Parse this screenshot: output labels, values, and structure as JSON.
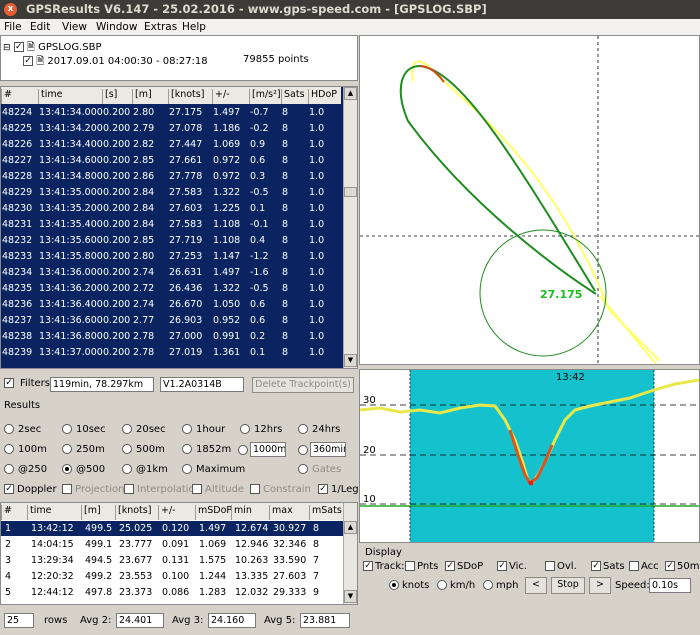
{
  "window": {
    "title": "GPSResults V6.147 - 25.02.2016 - www.gps-speed.com - [GPSLOG.SBP]",
    "close": "x"
  },
  "menu": [
    "File",
    "Edit",
    "View",
    "Window",
    "Extras",
    "Help"
  ],
  "tree": {
    "file": "GPSLOG.SBP",
    "session": "2017.09.01 04:00:30 - 08:27:18",
    "points": "79855 points"
  },
  "trackpoints": {
    "headers": [
      "#",
      "time",
      "[s]",
      "[m]",
      "[knots]",
      "+/-",
      "[m/s²]",
      "Sats",
      "HDoP"
    ],
    "rows": [
      [
        "48224",
        "13:41:34.000",
        "0.200",
        "2.80",
        "27.175",
        "1.497",
        "-0.7",
        "8",
        "1.0"
      ],
      [
        "48225",
        "13:41:34.200",
        "0.200",
        "2.79",
        "27.078",
        "1.186",
        "-0.2",
        "8",
        "1.0"
      ],
      [
        "48226",
        "13:41:34.400",
        "0.200",
        "2.82",
        "27.447",
        "1.069",
        "0.9",
        "8",
        "1.0"
      ],
      [
        "48227",
        "13:41:34.600",
        "0.200",
        "2.85",
        "27.661",
        "0.972",
        "0.6",
        "8",
        "1.0"
      ],
      [
        "48228",
        "13:41:34.800",
        "0.200",
        "2.86",
        "27.778",
        "0.972",
        "0.3",
        "8",
        "1.0"
      ],
      [
        "48229",
        "13:41:35.000",
        "0.200",
        "2.84",
        "27.583",
        "1.322",
        "-0.5",
        "8",
        "1.0"
      ],
      [
        "48230",
        "13:41:35.200",
        "0.200",
        "2.84",
        "27.603",
        "1.225",
        "0.1",
        "8",
        "1.0"
      ],
      [
        "48231",
        "13:41:35.400",
        "0.200",
        "2.84",
        "27.583",
        "1.108",
        "-0.1",
        "8",
        "1.0"
      ],
      [
        "48232",
        "13:41:35.600",
        "0.200",
        "2.85",
        "27.719",
        "1.108",
        "0.4",
        "8",
        "1.0"
      ],
      [
        "48233",
        "13:41:35.800",
        "0.200",
        "2.80",
        "27.253",
        "1.147",
        "-1.2",
        "8",
        "1.0"
      ],
      [
        "48234",
        "13:41:36.000",
        "0.200",
        "2.74",
        "26.631",
        "1.497",
        "-1.6",
        "8",
        "1.0"
      ],
      [
        "48235",
        "13:41:36.200",
        "0.200",
        "2.72",
        "26.436",
        "1.322",
        "-0.5",
        "8",
        "1.0"
      ],
      [
        "48236",
        "13:41:36.400",
        "0.200",
        "2.74",
        "26.670",
        "1.050",
        "0.6",
        "8",
        "1.0"
      ],
      [
        "48237",
        "13:41:36.600",
        "0.200",
        "2.77",
        "26.903",
        "0.952",
        "0.6",
        "8",
        "1.0"
      ],
      [
        "48238",
        "13:41:36.800",
        "0.200",
        "2.78",
        "27.000",
        "0.991",
        "0.2",
        "8",
        "1.0"
      ],
      [
        "48239",
        "13:41:37.000",
        "0.200",
        "2.78",
        "27.019",
        "1.361",
        "0.1",
        "8",
        "1.0"
      ]
    ]
  },
  "filters": {
    "label": "Filters",
    "checked": true,
    "value": "119min, 78.297km",
    "device": "V1.2A0314B",
    "delete_button": "Delete Trackpoint(s)"
  },
  "results": {
    "label": "Results",
    "options": [
      {
        "label": "2sec",
        "selected": false
      },
      {
        "label": "10sec",
        "selected": false
      },
      {
        "label": "20sec",
        "selected": false
      },
      {
        "label": "1hour",
        "selected": false
      },
      {
        "label": "12hrs",
        "selected": false
      },
      {
        "label": "24hrs",
        "selected": false
      },
      {
        "label": "100m",
        "selected": false
      },
      {
        "label": "250m",
        "selected": false
      },
      {
        "label": "500m",
        "selected": false
      },
      {
        "label": "1852m",
        "selected": false
      },
      {
        "label": "@250",
        "selected": false
      },
      {
        "label": "@500",
        "selected": true
      },
      {
        "label": "@1km",
        "selected": false
      },
      {
        "label": "Maximum",
        "selected": false
      },
      {
        "label": "Gates",
        "selected": false
      }
    ],
    "custom_a": "1000m",
    "custom_b": "360min",
    "checks": [
      {
        "label": "Doppler",
        "checked": true
      },
      {
        "label": "Projection",
        "checked": false
      },
      {
        "label": "Interpolation",
        "checked": false
      },
      {
        "label": "Altitude",
        "checked": false
      },
      {
        "label": "Constrain",
        "checked": false
      },
      {
        "label": "1/Leg",
        "checked": true
      }
    ]
  },
  "runs": {
    "headers": [
      "#",
      "time",
      "[m]",
      "[knots]",
      "+/-",
      "mSDoP",
      "min",
      "max",
      "mSats"
    ],
    "rows": [
      [
        "1",
        "13:42:12",
        "499.5",
        "25.025",
        "0.120",
        "1.497",
        "12.674",
        "30.927",
        "8"
      ],
      [
        "2",
        "14:04:15",
        "499.1",
        "23.777",
        "0.091",
        "1.069",
        "12.946",
        "32.346",
        "8"
      ],
      [
        "3",
        "13:29:34",
        "494.5",
        "23.677",
        "0.131",
        "1.575",
        "10.263",
        "33.590",
        "7"
      ],
      [
        "4",
        "12:20:32",
        "499.2",
        "23.553",
        "0.100",
        "1.244",
        "13.335",
        "27.603",
        "7"
      ],
      [
        "5",
        "12:44:12",
        "497.8",
        "23.373",
        "0.086",
        "1.283",
        "12.032",
        "29.333",
        "9"
      ]
    ]
  },
  "footer": {
    "rows_value": "25",
    "rows_label": "rows",
    "avg2_label": "Avg 2:",
    "avg2": "24.401",
    "avg3_label": "Avg 3:",
    "avg3": "24.160",
    "avg5_label": "Avg 5:",
    "avg5": "23.881"
  },
  "map": {
    "speed_label": "27.175"
  },
  "speed_graph": {
    "time_label": "13:42",
    "ylabels": [
      "30",
      "20",
      "10"
    ]
  },
  "display": {
    "label": "Display",
    "checks": [
      {
        "label": "Track:",
        "checked": true
      },
      {
        "label": "Pnts",
        "checked": false
      },
      {
        "label": "SDoP",
        "checked": true
      },
      {
        "label": "Vic.",
        "checked": true
      },
      {
        "label": "Ovl.",
        "checked": false
      },
      {
        "label": "Sats",
        "checked": true
      },
      {
        "label": "Acc",
        "checked": false
      },
      {
        "label": "50m",
        "checked": true
      }
    ],
    "units": [
      {
        "label": "knots",
        "selected": true
      },
      {
        "label": "km/h",
        "selected": false
      },
      {
        "label": "mph",
        "selected": false
      }
    ],
    "prev": "<",
    "stop": "Stop",
    "next": ">",
    "speed_label": "Speed:",
    "speed_value": "0.10s"
  },
  "colors": {
    "selection": "#0a2462",
    "track_green": "#1e8c1e",
    "track_yellow": "#ffff55",
    "cyan": "#14c1cd",
    "title_bg": "#3c3b37"
  }
}
